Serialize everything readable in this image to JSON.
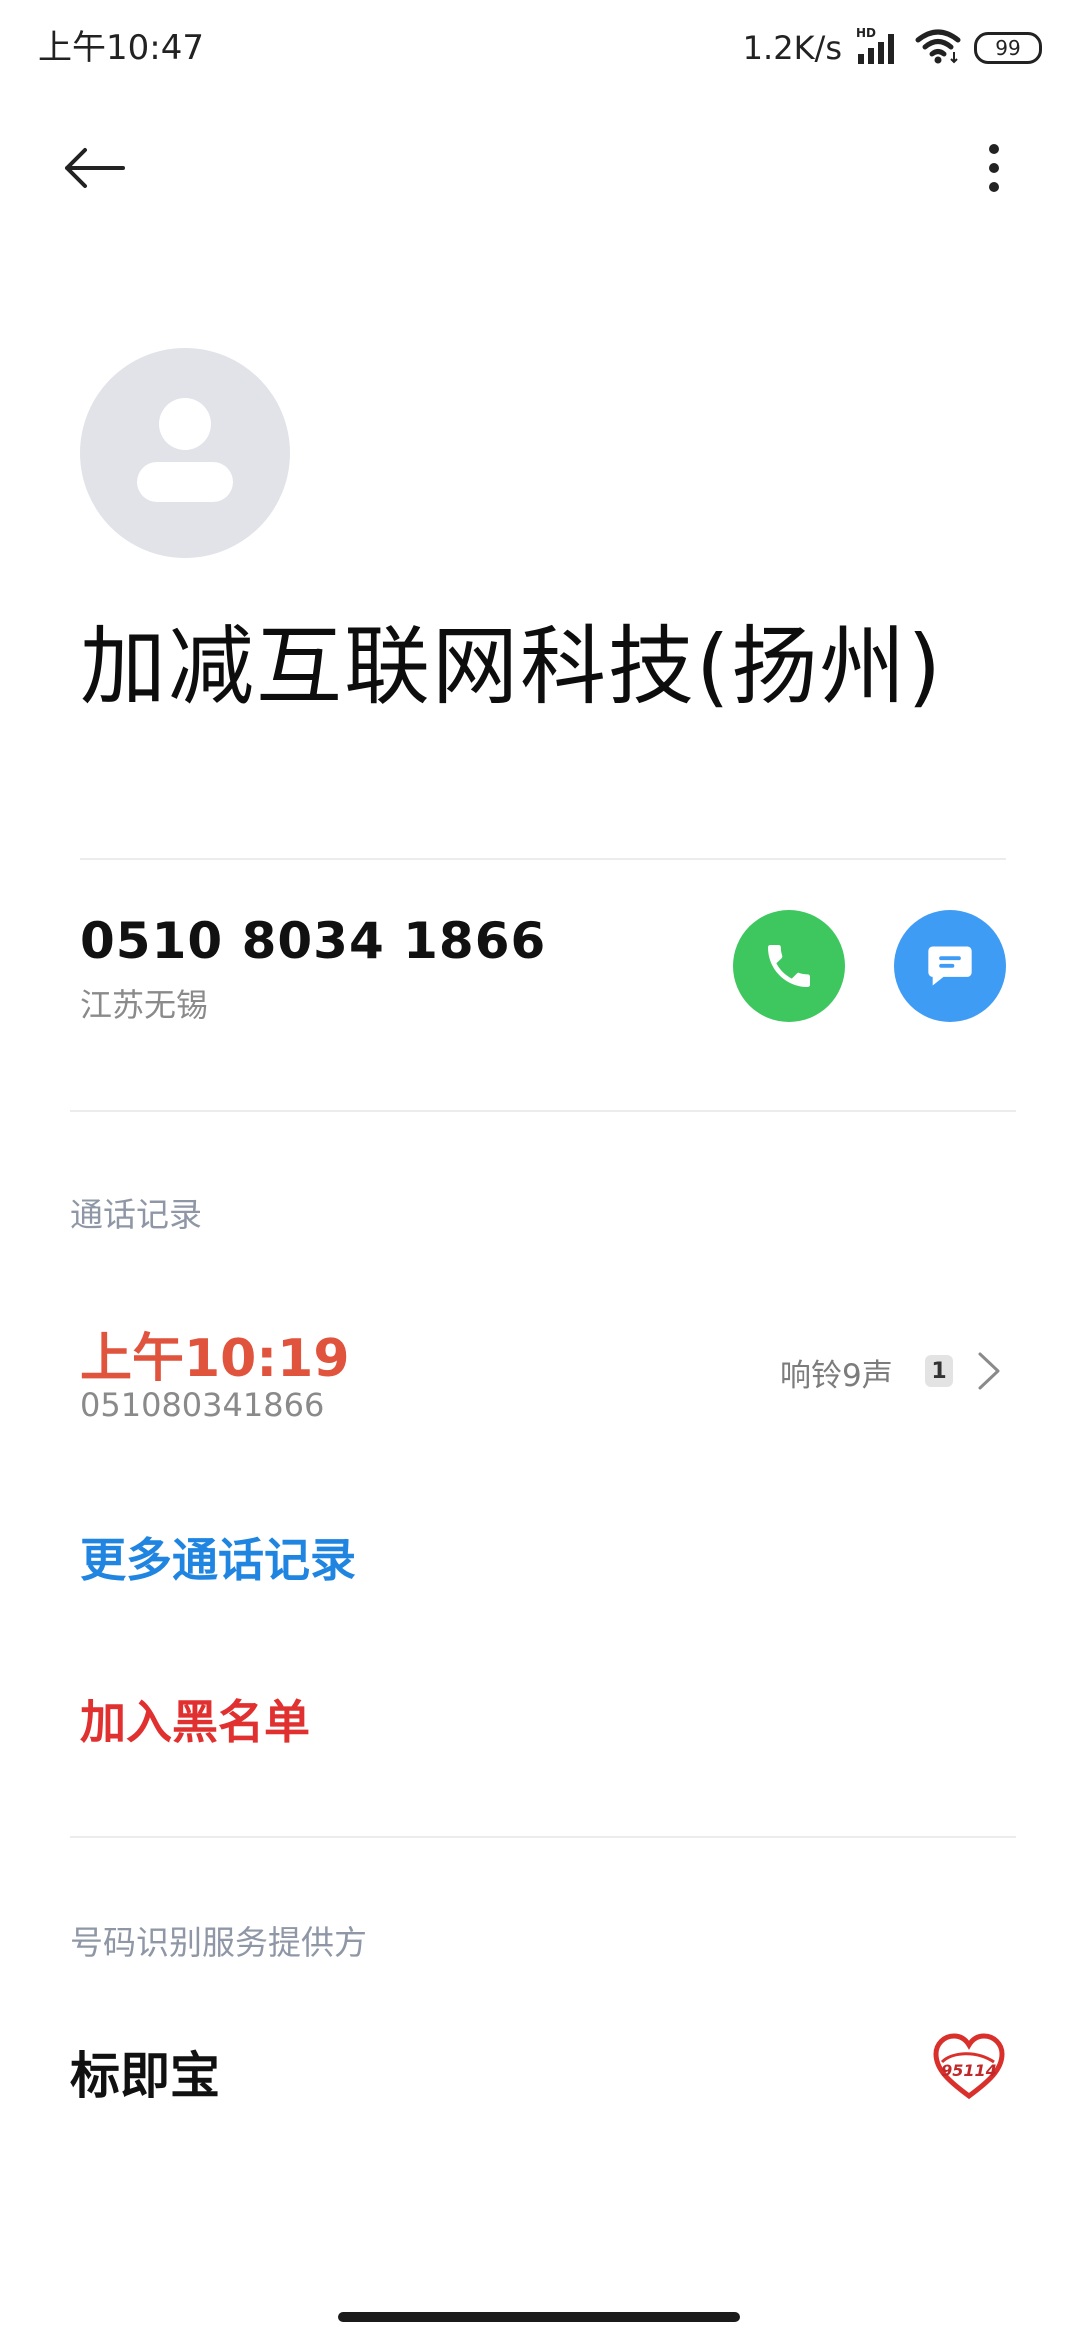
{
  "status_bar": {
    "time": "上午10:47",
    "net_speed": "1.2K/s",
    "hd_label": "HD",
    "battery": "99"
  },
  "contact": {
    "name": "加减互联网科技(扬州)",
    "number": "0510 8034 1866",
    "location": "江苏无锡"
  },
  "call_log": {
    "header": "通话记录",
    "entries": [
      {
        "time": "上午10:19",
        "number": "051080341866",
        "detail": "响铃9声",
        "sim": "1"
      }
    ],
    "more_label": "更多通话记录"
  },
  "actions": {
    "block_label": "加入黑名单"
  },
  "provider": {
    "header": "号码识别服务提供方",
    "name": "标即宝",
    "logo_text": "95114"
  },
  "colors": {
    "call_green": "#3ec75f",
    "message_blue": "#3f9cf5",
    "missed_red": "#e0533d",
    "link_blue": "#1f85e0",
    "block_red": "#e0302f"
  }
}
